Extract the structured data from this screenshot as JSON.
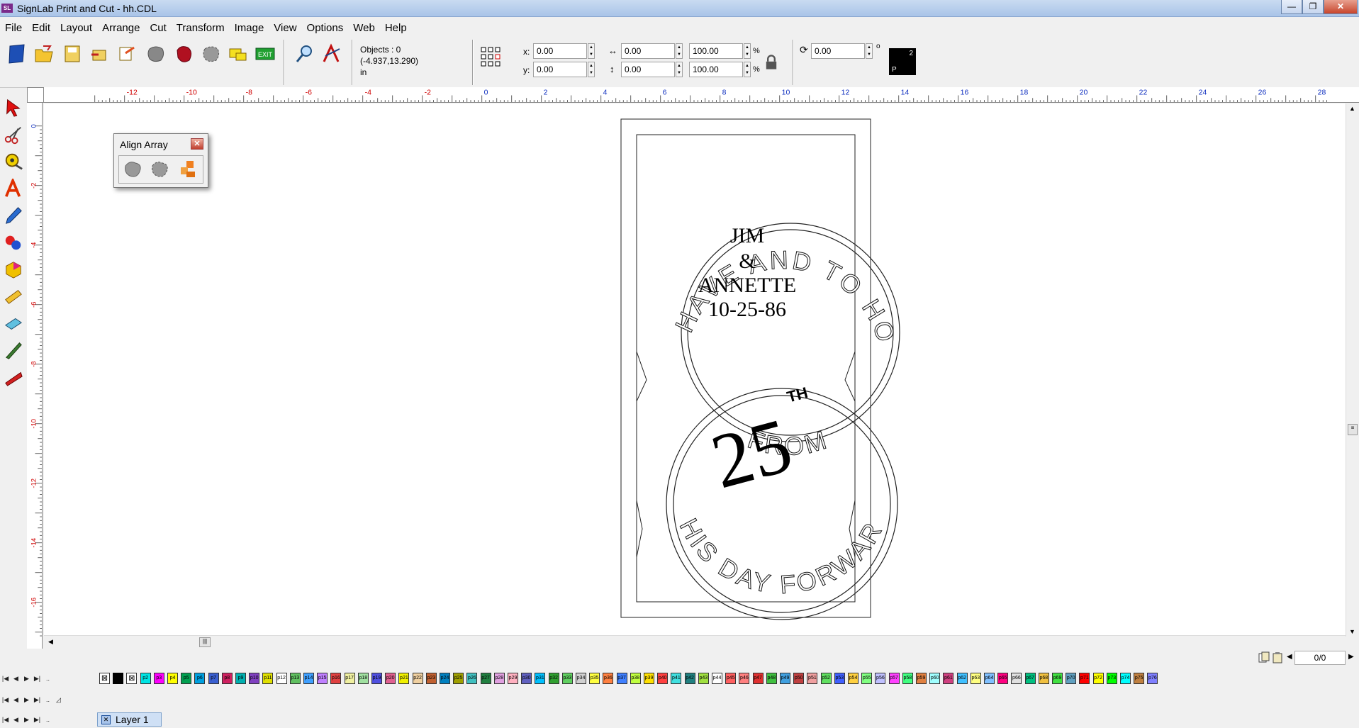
{
  "window": {
    "app_icon_text": "SL",
    "title": "SignLab Print and Cut - hh.CDL",
    "minimize": "—",
    "restore": "❐",
    "close": "✕"
  },
  "menu": [
    "File",
    "Edit",
    "Layout",
    "Arrange",
    "Cut",
    "Transform",
    "Image",
    "View",
    "Options",
    "Web",
    "Help"
  ],
  "toolbar": {
    "objects": "Objects : 0",
    "coords": "(-4.937,13.290)",
    "units": "in",
    "x_label": "x:",
    "x_value": "0.00",
    "y_label": "y:",
    "y_value": "0.00",
    "w_value": "0.00",
    "h_value": "0.00",
    "sx_value": "100.00",
    "sy_value": "100.00",
    "pct": "%",
    "rotate_value": "0.00",
    "degree": "o",
    "color_number": "2",
    "color_letter": "P"
  },
  "ruler": {
    "h_labels": [
      "-12",
      "-10",
      "-8",
      "-6",
      "-4",
      "-2",
      "0",
      "2",
      "4",
      "6",
      "8",
      "10",
      "12",
      "14",
      "16",
      "18",
      "20",
      "22",
      "24",
      "26",
      "28"
    ],
    "v_labels": [
      "0",
      "-2",
      "-4",
      "-6",
      "-8",
      "-10",
      "-12",
      "-14",
      "-16"
    ]
  },
  "align_palette": {
    "title": "Align Array",
    "close": "✕"
  },
  "design": {
    "name_line1": "JIM",
    "name_line2": "&",
    "name_line3": "ANNETTE",
    "date": "10-25-86",
    "top_arc": "TO HAVE AND TO HOLD",
    "middle_arc": "FROM",
    "bottom_arc": "THIS DAY FORWARD",
    "big_number": "25",
    "superscript": "TH"
  },
  "status": {
    "page_count": "0/0"
  },
  "layers": {
    "active_layer": "Layer 1"
  },
  "swatches": [
    {
      "label": "",
      "color": "#ffffff"
    },
    {
      "label": "",
      "color": "#000000"
    },
    {
      "label": "",
      "color": "#ffffff"
    },
    {
      "label": "p2",
      "color": "#00e5e5"
    },
    {
      "label": "p3",
      "color": "#ff00ff"
    },
    {
      "label": "p4",
      "color": "#ffff00"
    },
    {
      "label": "p5",
      "color": "#00a050"
    },
    {
      "label": "p6",
      "color": "#00a0e0"
    },
    {
      "label": "p7",
      "color": "#3a5fd0"
    },
    {
      "label": "p8",
      "color": "#d02060"
    },
    {
      "label": "p9",
      "color": "#00b0b0"
    },
    {
      "label": "p10",
      "color": "#8040c0"
    },
    {
      "label": "p11",
      "color": "#e0e000"
    },
    {
      "label": "p12",
      "color": "#ffffff"
    },
    {
      "label": "p13",
      "color": "#60c060"
    },
    {
      "label": "p14",
      "color": "#40a0ff"
    },
    {
      "label": "p15",
      "color": "#c080ff"
    },
    {
      "label": "p16",
      "color": "#e04040"
    },
    {
      "label": "p17",
      "color": "#f0f0a0"
    },
    {
      "label": "p18",
      "color": "#a0e0a0"
    },
    {
      "label": "p19",
      "color": "#5050e0"
    },
    {
      "label": "p20",
      "color": "#e06090"
    },
    {
      "label": "p21",
      "color": "#f0f000"
    },
    {
      "label": "p22",
      "color": "#f0d0a0"
    },
    {
      "label": "p23",
      "color": "#c06030"
    },
    {
      "label": "p24",
      "color": "#0080c0"
    },
    {
      "label": "p25",
      "color": "#a0a000"
    },
    {
      "label": "p26",
      "color": "#40c0c0"
    },
    {
      "label": "p27",
      "color": "#208040"
    },
    {
      "label": "p28",
      "color": "#e0a0e0"
    },
    {
      "label": "p29",
      "color": "#ffb0c0"
    },
    {
      "label": "p30",
      "color": "#6060c0"
    },
    {
      "label": "p31",
      "color": "#00c0ff"
    },
    {
      "label": "p32",
      "color": "#30a030"
    },
    {
      "label": "p33",
      "color": "#60d060"
    },
    {
      "label": "p34",
      "color": "#d0d0d0"
    },
    {
      "label": "p35",
      "color": "#ffff40"
    },
    {
      "label": "p36",
      "color": "#ff8040"
    },
    {
      "label": "p37",
      "color": "#4080ff"
    },
    {
      "label": "p38",
      "color": "#c0ff40"
    },
    {
      "label": "p39",
      "color": "#ffe000"
    },
    {
      "label": "p40",
      "color": "#ff4040"
    },
    {
      "label": "p41",
      "color": "#40e0e0"
    },
    {
      "label": "p42",
      "color": "#208080"
    },
    {
      "label": "p43",
      "color": "#a0e040"
    },
    {
      "label": "p44",
      "color": "#ffffff"
    },
    {
      "label": "p45",
      "color": "#ff6060"
    },
    {
      "label": "p46",
      "color": "#ff8080"
    },
    {
      "label": "p47",
      "color": "#e03030"
    },
    {
      "label": "p48",
      "color": "#40c040"
    },
    {
      "label": "p49",
      "color": "#40a0e0"
    },
    {
      "label": "p50",
      "color": "#c04040"
    },
    {
      "label": "p51",
      "color": "#f0a0a0"
    },
    {
      "label": "p52",
      "color": "#60e060"
    },
    {
      "label": "p53",
      "color": "#4060ff"
    },
    {
      "label": "p54",
      "color": "#ffd040"
    },
    {
      "label": "p55",
      "color": "#80ff80"
    },
    {
      "label": "p56",
      "color": "#c0c0ff"
    },
    {
      "label": "p57",
      "color": "#ff40ff"
    },
    {
      "label": "p58",
      "color": "#40ff80"
    },
    {
      "label": "p59",
      "color": "#e08040"
    },
    {
      "label": "p60",
      "color": "#a0ffff"
    },
    {
      "label": "p61",
      "color": "#d04080"
    },
    {
      "label": "p62",
      "color": "#40c0ff"
    },
    {
      "label": "p63",
      "color": "#ffff80"
    },
    {
      "label": "p64",
      "color": "#80c0ff"
    },
    {
      "label": "p65",
      "color": "#ff0080"
    },
    {
      "label": "p66",
      "color": "#e0e0e0"
    },
    {
      "label": "p67",
      "color": "#00c080"
    },
    {
      "label": "p68",
      "color": "#f0c040"
    },
    {
      "label": "p69",
      "color": "#40e040"
    },
    {
      "label": "p70",
      "color": "#60a0c0"
    },
    {
      "label": "p71",
      "color": "#ff0000"
    },
    {
      "label": "p72",
      "color": "#ffff00"
    },
    {
      "label": "p73",
      "color": "#00ff00"
    },
    {
      "label": "p74",
      "color": "#00ffff"
    },
    {
      "label": "p75",
      "color": "#c08040"
    },
    {
      "label": "p76",
      "color": "#8080ff"
    }
  ]
}
